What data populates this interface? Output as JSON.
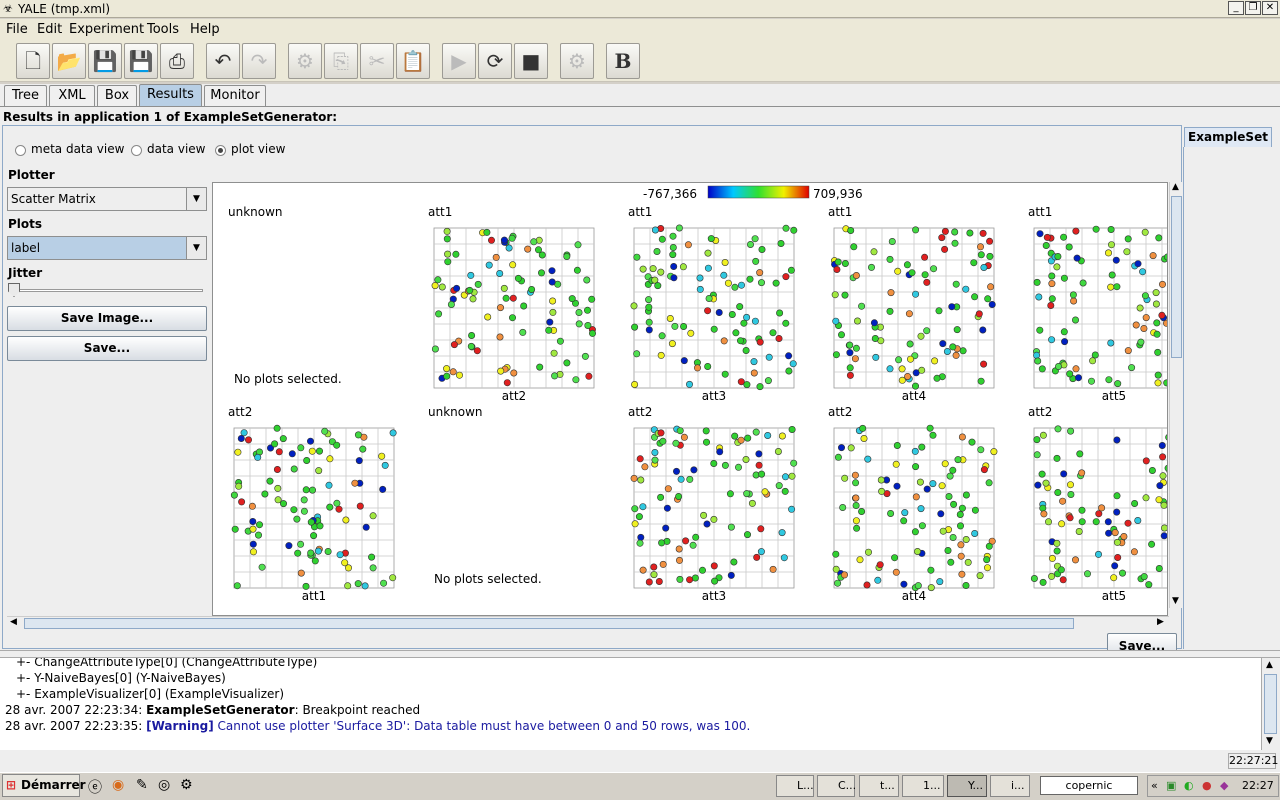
{
  "window": {
    "title": "YALE (tmp.xml)"
  },
  "menubar": {
    "items": [
      "File",
      "Edit",
      "Experiment",
      "Tools",
      "Help"
    ]
  },
  "tabs": {
    "items": [
      "Tree",
      "XML",
      "Box",
      "Results",
      "Monitor"
    ],
    "active": "Results"
  },
  "results": {
    "header": "Results in application 1 of ExampleSetGenerator:",
    "side_tab": "ExampleSet",
    "views": {
      "meta": "meta data view",
      "data": "data view",
      "plot": "plot view",
      "selected": "plot view"
    }
  },
  "left_panel": {
    "plotter_label": "Plotter",
    "plotter_value": "Scatter Matrix",
    "plots_label": "Plots",
    "plots_value": "label",
    "jitter_label": "Jitter",
    "jitter_level": 0,
    "save_image_label": "Save Image...",
    "save_label": "Save..."
  },
  "chart_data": {
    "type": "scatter",
    "title": "",
    "color_scale": {
      "min_label": "-767,366",
      "max_label": "709,936"
    },
    "no_plot_text": "No plots selected.",
    "cells": [
      {
        "row": 0,
        "col": 0,
        "ylabel": "unknown",
        "xlabel": "",
        "empty": true
      },
      {
        "row": 0,
        "col": 1,
        "ylabel": "att1",
        "xlabel": "att2"
      },
      {
        "row": 0,
        "col": 2,
        "ylabel": "att1",
        "xlabel": "att3"
      },
      {
        "row": 0,
        "col": 3,
        "ylabel": "att1",
        "xlabel": "att4"
      },
      {
        "row": 0,
        "col": 4,
        "ylabel": "att1",
        "xlabel": "att5"
      },
      {
        "row": 1,
        "col": 0,
        "ylabel": "att2",
        "xlabel": "att1"
      },
      {
        "row": 1,
        "col": 1,
        "ylabel": "unknown",
        "xlabel": "",
        "empty": true
      },
      {
        "row": 1,
        "col": 2,
        "ylabel": "att2",
        "xlabel": "att3"
      },
      {
        "row": 1,
        "col": 3,
        "ylabel": "att2",
        "xlabel": "att4"
      },
      {
        "row": 1,
        "col": 4,
        "ylabel": "att2",
        "xlabel": "att5"
      }
    ],
    "points_per_plot": 100,
    "grid": true
  },
  "save_button": "Save...",
  "log": {
    "lines": [
      {
        "prefix": "",
        "bold": "",
        "text": "+- ChangeAttributeType[0] (ChangeAttributeType)",
        "indent": true
      },
      {
        "prefix": "",
        "bold": "",
        "text": "+- Y-NaiveBayes[0] (Y-NaiveBayes)",
        "indent": true
      },
      {
        "prefix": "",
        "bold": "",
        "text": "+- ExampleVisualizer[0] (ExampleVisualizer)",
        "indent": true
      },
      {
        "prefix": "28 avr. 2007 22:23:34: ",
        "bold": "ExampleSetGenerator",
        "text": ": Breakpoint reached",
        "indent": false
      },
      {
        "prefix": "28 avr. 2007 22:23:35: ",
        "bold": "[Warning]",
        "text": " Cannot use plotter 'Surface 3D': Data table must have between 0 and 50 rows, was 100.",
        "indent": false
      }
    ]
  },
  "status": {
    "clock": "22:27:21"
  },
  "taskbar": {
    "start": "Démarrer",
    "tasks": [
      "L...",
      "C...",
      "t...",
      "1...",
      "Y...",
      "i..."
    ],
    "search": "copernic",
    "time": "22:27"
  }
}
